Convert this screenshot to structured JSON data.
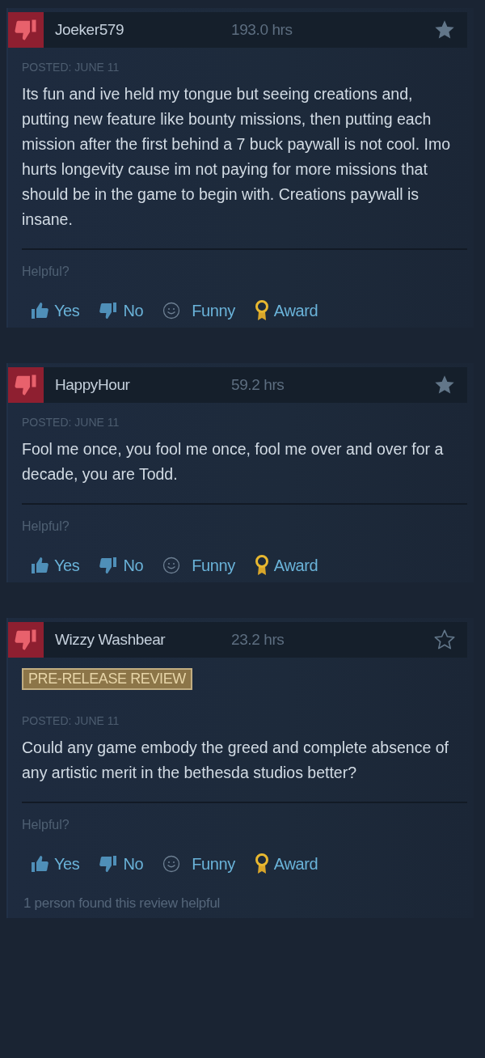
{
  "reviews": [
    {
      "recommended": false,
      "author": "Joeker579",
      "hours": "193.0 hrs",
      "starred": true,
      "posted": "POSTED: JUNE 11",
      "text": "Its fun and ive held my tongue but seeing creations and, putting new feature like bounty missions, then putting each mission after the first behind a 7 buck paywall is not cool. Imo hurts longevity cause im not paying for more missions that should be in the game to begin with. Creations paywall is insane.",
      "helpful_prompt": "Helpful?",
      "votes": [
        {
          "kind": "yes",
          "label": "Yes"
        },
        {
          "kind": "no",
          "label": "No"
        },
        {
          "kind": "funny",
          "label": "Funny"
        },
        {
          "kind": "award",
          "label": "Award"
        }
      ]
    },
    {
      "recommended": false,
      "author": "HappyHour",
      "hours": "59.2 hrs",
      "starred": true,
      "posted": "POSTED: JUNE 11",
      "text": "Fool me once, you fool me once, fool me over and over for a decade, you are Todd.",
      "helpful_prompt": "Helpful?",
      "votes": [
        {
          "kind": "yes",
          "label": "Yes"
        },
        {
          "kind": "no",
          "label": "No"
        },
        {
          "kind": "funny",
          "label": "Funny"
        },
        {
          "kind": "award",
          "label": "Award"
        }
      ]
    },
    {
      "recommended": false,
      "author": "Wizzy Washbear",
      "hours": "23.2 hrs",
      "starred": false,
      "badge": "PRE-RELEASE REVIEW",
      "posted": "POSTED: JUNE 11",
      "text": "Could any game embody the greed and complete absence of any artistic merit in the bethesda studios better?",
      "helpful_prompt": "Helpful?",
      "votes": [
        {
          "kind": "yes",
          "label": "Yes"
        },
        {
          "kind": "no",
          "label": "No"
        },
        {
          "kind": "funny",
          "label": "Funny"
        },
        {
          "kind": "award",
          "label": "Award"
        }
      ],
      "footer": "1 person found this review helpful"
    }
  ]
}
